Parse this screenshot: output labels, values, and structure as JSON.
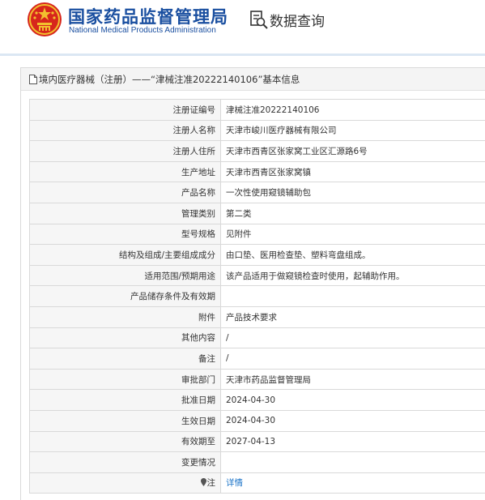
{
  "header": {
    "site_name": "国家药品监督管理局",
    "site_name_en": "National Medical Products Administration",
    "query_label": "数据查询"
  },
  "panel": {
    "title": "境内医疗器械（注册）——“津械注准20222140106”基本信息"
  },
  "rows": [
    {
      "label": "注册证编号",
      "value": "津械注准20222140106"
    },
    {
      "label": "注册人名称",
      "value": "天津市峻川医疗器械有限公司"
    },
    {
      "label": "注册人住所",
      "value": "天津市西青区张家窝工业区汇源路6号"
    },
    {
      "label": "生产地址",
      "value": "天津市西青区张家窝镇"
    },
    {
      "label": "产品名称",
      "value": "一次性使用窥镜辅助包"
    },
    {
      "label": "管理类别",
      "value": "第二类"
    },
    {
      "label": "型号规格",
      "value": "见附件"
    },
    {
      "label": "结构及组成/主要组成成分",
      "value": "由口垫、医用检查垫、塑料弯盘组成。"
    },
    {
      "label": "适用范围/预期用途",
      "value": "该产品适用于做窥镜检查时使用，起辅助作用。"
    },
    {
      "label": "产品储存条件及有效期",
      "value": ""
    },
    {
      "label": "附件",
      "value": "产品技术要求"
    },
    {
      "label": "其他内容",
      "value": "/"
    },
    {
      "label": "备注",
      "value": "/"
    },
    {
      "label": "审批部门",
      "value": "天津市药品监督管理局"
    },
    {
      "label": "批准日期",
      "value": "2024-04-30"
    },
    {
      "label": "生效日期",
      "value": "2024-04-30"
    },
    {
      "label": "有效期至",
      "value": "2027-04-13"
    },
    {
      "label": "变更情况",
      "value": ""
    },
    {
      "label": "注",
      "value": "详情"
    }
  ],
  "colors": {
    "brand_blue": "#1a4fa0",
    "link_blue": "#1a73c8",
    "emblem_red": "#d7261c",
    "emblem_gold": "#f2c12e"
  },
  "icons": {
    "emblem": "national-emblem-icon",
    "query": "data-query-icon",
    "panel": "document-icon",
    "note": "location-pin-icon"
  }
}
